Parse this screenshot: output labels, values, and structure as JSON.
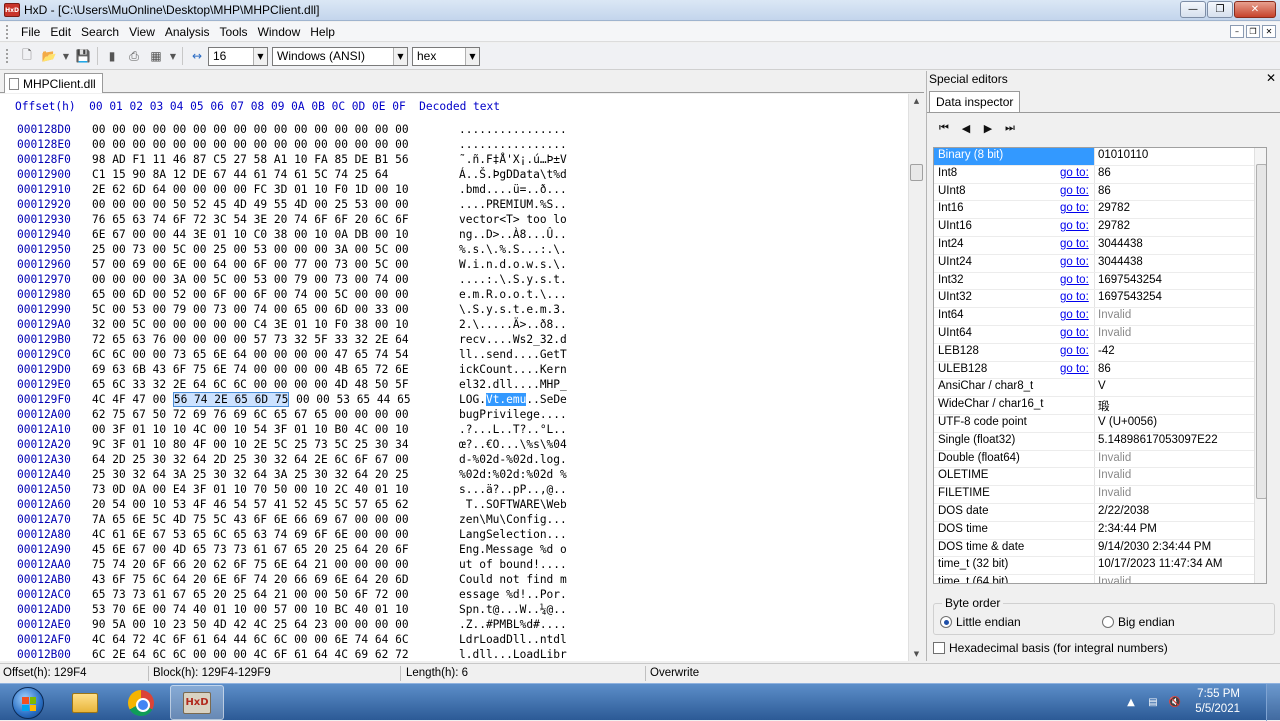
{
  "window": {
    "title": "HxD - [C:\\Users\\MuOnline\\Desktop\\MHP\\MHPClient.dll]",
    "logo_text": "HxD"
  },
  "menu": [
    "File",
    "Edit",
    "Search",
    "View",
    "Analysis",
    "Tools",
    "Window",
    "Help"
  ],
  "toolbar": {
    "bytes_per_row": "16",
    "charset": "Windows (ANSI)",
    "offset_base": "hex"
  },
  "document_tab": "MHPClient.dll",
  "hex": {
    "header_offset": "Offset(h)",
    "header_columns": "00 01 02 03 04 05 06 07 08 09 0A 0B 0C 0D 0E 0F",
    "header_decoded": "Decoded text",
    "rows": [
      {
        "offset": "000128D0",
        "bytes": "00 00 00 00 00 00 00 00 00 00 00 00 00 00 00 00",
        "text": "................"
      },
      {
        "offset": "000128E0",
        "bytes": "00 00 00 00 00 00 00 00 00 00 00 00 00 00 00 00",
        "text": "................"
      },
      {
        "offset": "000128F0",
        "bytes": "98 AD F1 11 46 87 C5 27 58 A1 10 FA 85 DE B1 56",
        "text": "˜.ñ.F‡Å'X¡.ú…Þ±V"
      },
      {
        "offset": "00012900",
        "bytes": "C1 15 90 8A 12 DE 67 44 61 74 61 5C 74 25 64",
        "text": "Á..Š.ÞgDData\\t%d"
      },
      {
        "offset": "00012910",
        "bytes": "2E 62 6D 64 00 00 00 00 FC 3D 01 10 F0 1D 00 10",
        "text": ".bmd....ü=..ð..."
      },
      {
        "offset": "00012920",
        "bytes": "00 00 00 00 50 52 45 4D 49 55 4D 00 25 53 00 00",
        "text": "....PREMIUM.%S.."
      },
      {
        "offset": "00012930",
        "bytes": "76 65 63 74 6F 72 3C 54 3E 20 74 6F 6F 20 6C 6F",
        "text": "vector<T> too lo"
      },
      {
        "offset": "00012940",
        "bytes": "6E 67 00 00 44 3E 01 10 C0 38 00 10 0A DB 00 10",
        "text": "ng..D>..À8...Û.."
      },
      {
        "offset": "00012950",
        "bytes": "25 00 73 00 5C 00 25 00 53 00 00 00 3A 00 5C 00",
        "text": "%.s.\\.%.S...:.\\."
      },
      {
        "offset": "00012960",
        "bytes": "57 00 69 00 6E 00 64 00 6F 00 77 00 73 00 5C 00",
        "text": "W.i.n.d.o.w.s.\\."
      },
      {
        "offset": "00012970",
        "bytes": "00 00 00 00 3A 00 5C 00 53 00 79 00 73 00 74 00",
        "text": "....:.\\.S.y.s.t."
      },
      {
        "offset": "00012980",
        "bytes": "65 00 6D 00 52 00 6F 00 6F 00 74 00 5C 00 00 00",
        "text": "e.m.R.o.o.t.\\..."
      },
      {
        "offset": "00012990",
        "bytes": "5C 00 53 00 79 00 73 00 74 00 65 00 6D 00 33 00",
        "text": "\\.S.y.s.t.e.m.3."
      },
      {
        "offset": "000129A0",
        "bytes": "32 00 5C 00 00 00 00 00 C4 3E 01 10 F0 38 00 10",
        "text": "2.\\.....Ä>..ð8.."
      },
      {
        "offset": "000129B0",
        "bytes": "72 65 63 76 00 00 00 00 57 73 32 5F 33 32 2E 64",
        "text": "recv....Ws2_32.d"
      },
      {
        "offset": "000129C0",
        "bytes": "6C 6C 00 00 73 65 6E 64 00 00 00 00 47 65 74 54",
        "text": "ll..send....GetT"
      },
      {
        "offset": "000129D0",
        "bytes": "69 63 6B 43 6F 75 6E 74 00 00 00 00 4B 65 72 6E",
        "text": "ickCount....Kern"
      },
      {
        "offset": "000129E0",
        "bytes": "65 6C 33 32 2E 64 6C 6C 00 00 00 00 4D 48 50 5F",
        "text": "el32.dll....MHP_"
      },
      {
        "offset": "000129F0",
        "bytes_pre": "4C 4F 47 00 ",
        "bytes_sel": "56 74 2E 65 6D 75",
        "bytes_post": " 00 00 53 65 44 65",
        "text_pre": "LOG.",
        "text_sel": "Vt.emu",
        "text_post": "..SeDe"
      },
      {
        "offset": "00012A00",
        "bytes": "62 75 67 50 72 69 76 69 6C 65 67 65 00 00 00 00",
        "text": "bugPrivilege...."
      },
      {
        "offset": "00012A10",
        "bytes": "00 3F 01 10 10 4C 00 10 54 3F 01 10 B0 4C 00 10",
        "text": ".?...L..T?..°L.."
      },
      {
        "offset": "00012A20",
        "bytes": "9C 3F 01 10 80 4F 00 10 2E 5C 25 73 5C 25 30 34",
        "text": "œ?..€O...\\%s\\%04"
      },
      {
        "offset": "00012A30",
        "bytes": "64 2D 25 30 32 64 2D 25 30 32 64 2E 6C 6F 67 00",
        "text": "d-%02d-%02d.log."
      },
      {
        "offset": "00012A40",
        "bytes": "25 30 32 64 3A 25 30 32 64 3A 25 30 32 64 20 25",
        "text": "%02d:%02d:%02d %"
      },
      {
        "offset": "00012A50",
        "bytes": "73 0D 0A 00 E4 3F 01 10 70 50 00 10 2C 40 01 10",
        "text": "s...ä?..pP..,@.."
      },
      {
        "offset": "00012A60",
        "bytes": "20 54 00 10 53 4F 46 54 57 41 52 45 5C 57 65 62",
        "text": " T..SOFTWARE\\Web"
      },
      {
        "offset": "00012A70",
        "bytes": "7A 65 6E 5C 4D 75 5C 43 6F 6E 66 69 67 00 00 00",
        "text": "zen\\Mu\\Config..."
      },
      {
        "offset": "00012A80",
        "bytes": "4C 61 6E 67 53 65 6C 65 63 74 69 6F 6E 00 00 00",
        "text": "LangSelection..."
      },
      {
        "offset": "00012A90",
        "bytes": "45 6E 67 00 4D 65 73 73 61 67 65 20 25 64 20 6F",
        "text": "Eng.Message %d o"
      },
      {
        "offset": "00012AA0",
        "bytes": "75 74 20 6F 66 20 62 6F 75 6E 64 21 00 00 00 00",
        "text": "ut of bound!...."
      },
      {
        "offset": "00012AB0",
        "bytes": "43 6F 75 6C 64 20 6E 6F 74 20 66 69 6E 64 20 6D",
        "text": "Could not find m"
      },
      {
        "offset": "00012AC0",
        "bytes": "65 73 73 61 67 65 20 25 64 21 00 00 50 6F 72 00",
        "text": "essage %d!..Por."
      },
      {
        "offset": "00012AD0",
        "bytes": "53 70 6E 00 74 40 01 10 00 57 00 10 BC 40 01 10",
        "text": "Spn.t@...W..¼@.."
      },
      {
        "offset": "00012AE0",
        "bytes": "90 5A 00 10 23 50 4D 42 4C 25 64 23 00 00 00 00",
        "text": ".Z..#PMBL%d#...."
      },
      {
        "offset": "00012AF0",
        "bytes": "4C 64 72 4C 6F 61 64 44 6C 6C 00 00 6E 74 64 6C",
        "text": "LdrLoadDll..ntdl"
      },
      {
        "offset": "00012B00",
        "bytes": "6C 2E 64 6C 6C 00 00 00 4C 6F 61 64 4C 69 62 72",
        "text": "l.dll...LoadLibr"
      }
    ]
  },
  "special_editors": {
    "title": "Special editors",
    "tab": "Data inspector",
    "goto_label": "go to:",
    "rows": [
      {
        "name": "Binary (8 bit)",
        "goto": false,
        "value": "01010110",
        "invalid": false
      },
      {
        "name": "Int8",
        "goto": true,
        "value": "86",
        "invalid": false
      },
      {
        "name": "UInt8",
        "goto": true,
        "value": "86",
        "invalid": false
      },
      {
        "name": "Int16",
        "goto": true,
        "value": "29782",
        "invalid": false
      },
      {
        "name": "UInt16",
        "goto": true,
        "value": "29782",
        "invalid": false
      },
      {
        "name": "Int24",
        "goto": true,
        "value": "3044438",
        "invalid": false
      },
      {
        "name": "UInt24",
        "goto": true,
        "value": "3044438",
        "invalid": false
      },
      {
        "name": "Int32",
        "goto": true,
        "value": "1697543254",
        "invalid": false
      },
      {
        "name": "UInt32",
        "goto": true,
        "value": "1697543254",
        "invalid": false
      },
      {
        "name": "Int64",
        "goto": true,
        "value": "Invalid",
        "invalid": true
      },
      {
        "name": "UInt64",
        "goto": true,
        "value": "Invalid",
        "invalid": true
      },
      {
        "name": "LEB128",
        "goto": true,
        "value": "-42",
        "invalid": false
      },
      {
        "name": "ULEB128",
        "goto": true,
        "value": "86",
        "invalid": false
      },
      {
        "name": "AnsiChar / char8_t",
        "goto": false,
        "value": "V",
        "invalid": false
      },
      {
        "name": "WideChar / char16_t",
        "goto": false,
        "value": "瑖",
        "invalid": false
      },
      {
        "name": "UTF-8 code point",
        "goto": false,
        "value": "V (U+0056)",
        "invalid": false
      },
      {
        "name": "Single (float32)",
        "goto": false,
        "value": "5.14898617053097E22",
        "invalid": false
      },
      {
        "name": "Double (float64)",
        "goto": false,
        "value": "Invalid",
        "invalid": true
      },
      {
        "name": "OLETIME",
        "goto": false,
        "value": "Invalid",
        "invalid": true
      },
      {
        "name": "FILETIME",
        "goto": false,
        "value": "Invalid",
        "invalid": true
      },
      {
        "name": "DOS date",
        "goto": false,
        "value": "2/22/2038",
        "invalid": false
      },
      {
        "name": "DOS time",
        "goto": false,
        "value": "2:34:44 PM",
        "invalid": false
      },
      {
        "name": "DOS time & date",
        "goto": false,
        "value": "9/14/2030 2:34:44 PM",
        "invalid": false
      },
      {
        "name": "time_t (32 bit)",
        "goto": false,
        "value": "10/17/2023 11:47:34 AM",
        "invalid": false
      },
      {
        "name": "time_t (64 bit)",
        "goto": false,
        "value": "Invalid",
        "invalid": true
      }
    ],
    "byte_order": {
      "label": "Byte order",
      "little": "Little endian",
      "big": "Big endian",
      "selected": "little"
    },
    "hex_basis": "Hexadecimal basis (for integral numbers)"
  },
  "status": {
    "offset": "Offset(h): 129F4",
    "block": "Block(h): 129F4-129F9",
    "length": "Length(h): 6",
    "mode": "Overwrite"
  },
  "taskbar": {
    "time": "7:55 PM",
    "date": "5/5/2021",
    "hxd_label": "HxD"
  }
}
